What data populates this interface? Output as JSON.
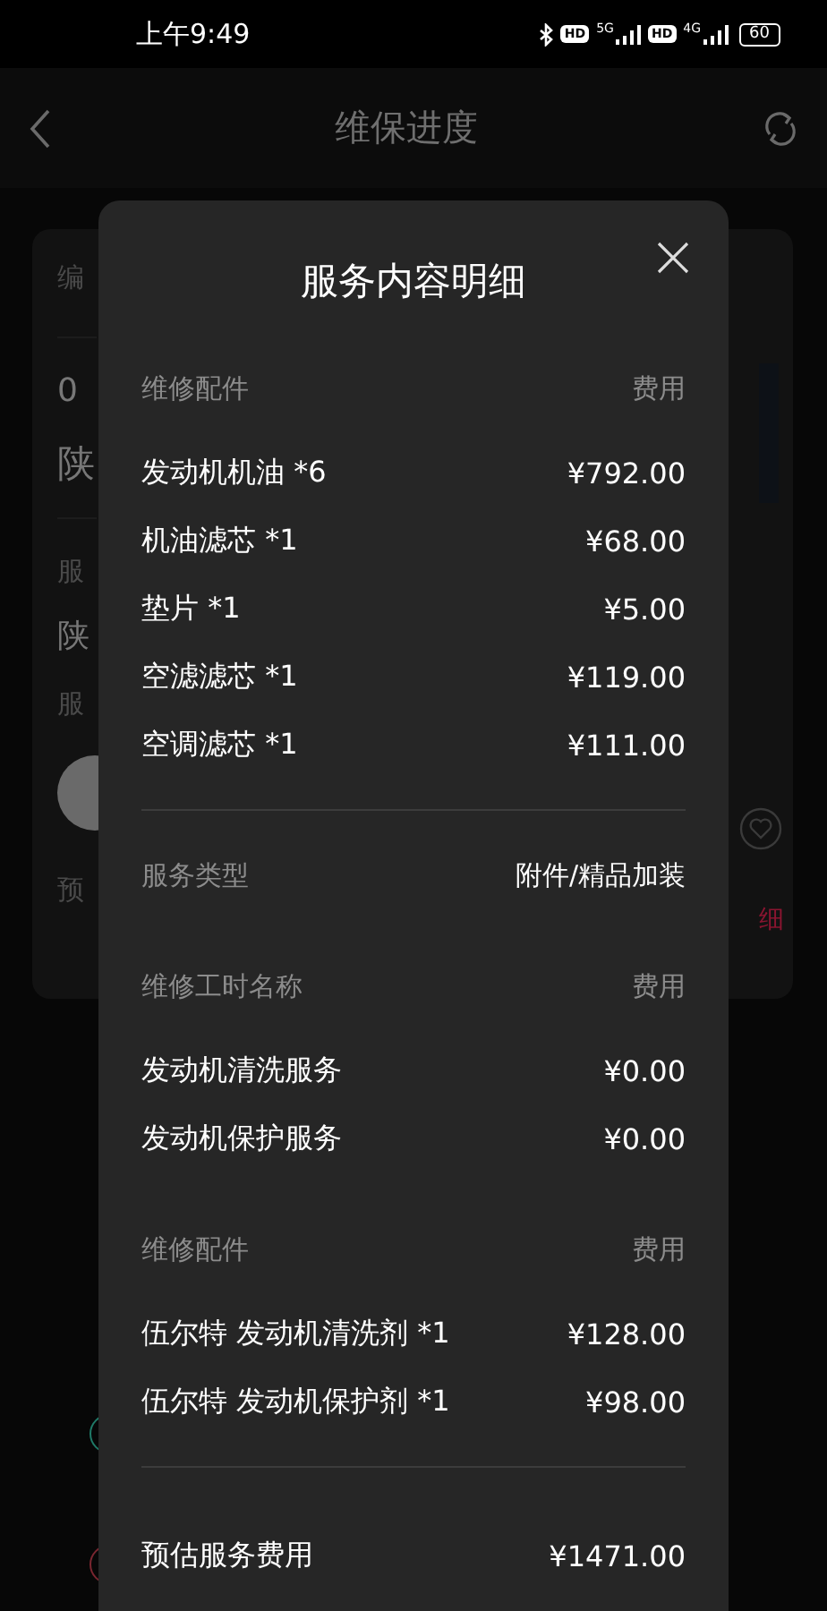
{
  "status_bar": {
    "time": "上午9:49",
    "networks": [
      {
        "hd": "HD",
        "type": "5G"
      },
      {
        "hd": "HD",
        "type": "4G"
      }
    ],
    "battery": "60"
  },
  "header": {
    "title": "维保进度"
  },
  "background_card": {
    "groups": [
      [
        {
          "kind": "label",
          "text": "编"
        }
      ],
      [
        {
          "kind": "value",
          "text": "0"
        },
        {
          "kind": "title",
          "text": "陕"
        }
      ],
      [
        {
          "kind": "label",
          "text": "服"
        },
        {
          "kind": "value",
          "text": "陕"
        },
        {
          "kind": "label",
          "text": "服"
        },
        {
          "kind": "avatar"
        },
        {
          "kind": "label",
          "text": "预"
        }
      ]
    ],
    "link": "细"
  },
  "timeline": [
    {
      "color": "#1f7a68"
    },
    {
      "color": "#7a2630"
    }
  ],
  "modal": {
    "title": "服务内容明细",
    "sections": [
      {
        "kind": "items",
        "heading": "维修配件",
        "heading_right": "费用",
        "divider": true,
        "rows": [
          {
            "name": "发动机机油 *6",
            "price": "¥792.00"
          },
          {
            "name": "机油滤芯 *1",
            "price": "¥68.00"
          },
          {
            "name": "垫片 *1",
            "price": "¥5.00"
          },
          {
            "name": "空滤滤芯 *1",
            "price": "¥119.00"
          },
          {
            "name": "空调滤芯 *1",
            "price": "¥111.00"
          }
        ]
      },
      {
        "kind": "field",
        "label": "服务类型",
        "value": "附件/精品加装",
        "divider": false
      },
      {
        "kind": "items",
        "heading": "维修工时名称",
        "heading_right": "费用",
        "divider": false,
        "rows": [
          {
            "name": "发动机清洗服务",
            "price": "¥0.00"
          },
          {
            "name": "发动机保护服务",
            "price": "¥0.00"
          }
        ]
      },
      {
        "kind": "items",
        "heading": "维修配件",
        "heading_right": "费用",
        "divider": true,
        "rows": [
          {
            "name": "伍尔特 发动机清洗剂 *1",
            "price": "¥128.00"
          },
          {
            "name": "伍尔特 发动机保护剂 *1",
            "price": "¥98.00"
          }
        ]
      }
    ],
    "total": {
      "label": "预估服务费用",
      "value": "¥1471.00"
    }
  }
}
